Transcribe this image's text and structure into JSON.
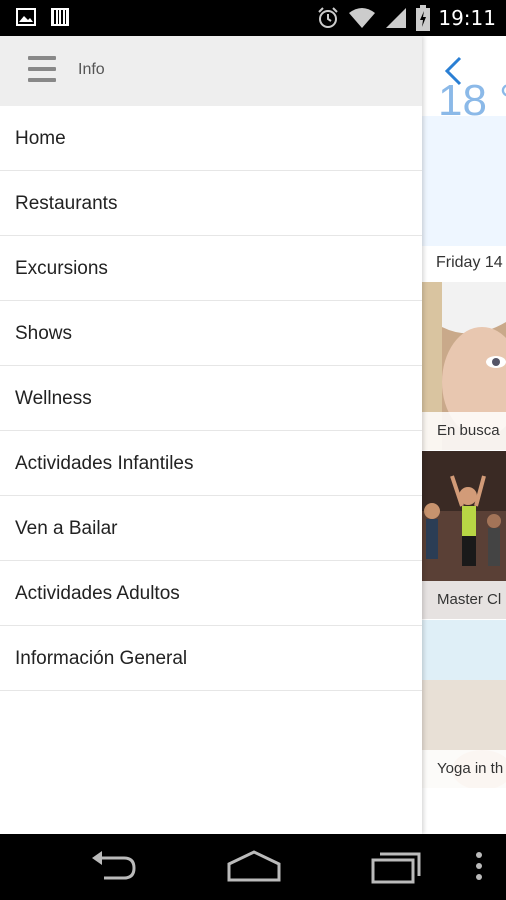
{
  "status_bar": {
    "time": "19:11",
    "icons": [
      "image-icon",
      "barcode-icon",
      "alarm-icon",
      "wifi-icon",
      "signal-icon",
      "battery-icon"
    ]
  },
  "drawer": {
    "header_title": "Info",
    "items": [
      {
        "label": "Home"
      },
      {
        "label": "Restaurants"
      },
      {
        "label": "Excursions"
      },
      {
        "label": "Shows"
      },
      {
        "label": "Wellness"
      },
      {
        "label": "Actividades Infantiles"
      },
      {
        "label": "Ven a Bailar"
      },
      {
        "label": "Actividades Adultos"
      },
      {
        "label": "Información General"
      }
    ]
  },
  "content": {
    "temperature": "18 °",
    "date": "Friday 14",
    "cards": [
      {
        "caption": "En busca"
      },
      {
        "caption": "Master Cl"
      },
      {
        "caption": "Yoga in th"
      }
    ]
  },
  "colors": {
    "accent": "#2a7fd4",
    "drawer_header": "#eeeeee",
    "temp_text": "#8bb9e8"
  },
  "navigation_bar": {
    "buttons": [
      "back-icon",
      "home-icon",
      "recents-icon",
      "menu-dots-icon"
    ]
  }
}
